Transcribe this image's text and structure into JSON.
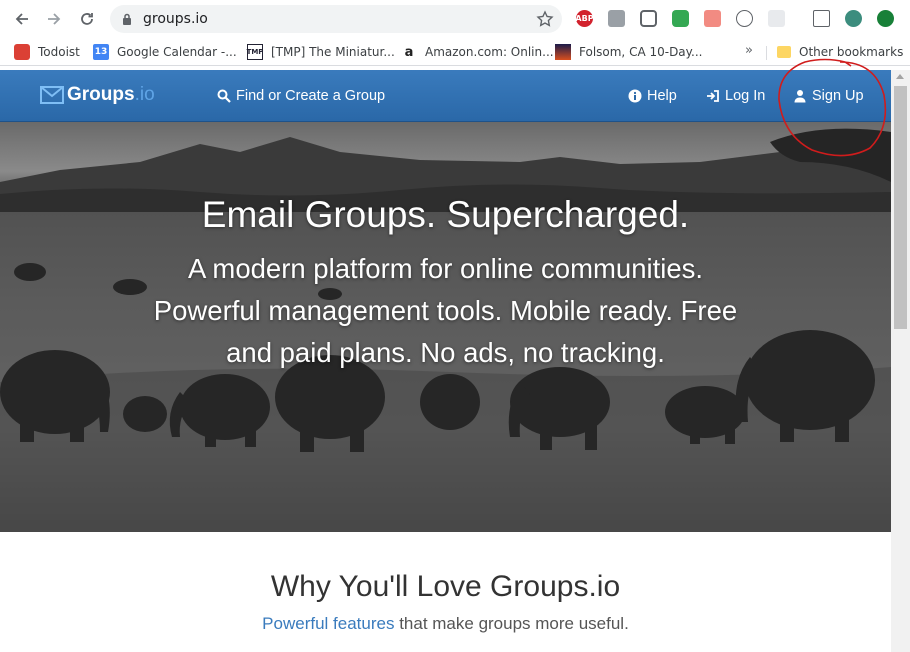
{
  "browser": {
    "url": "groups.io",
    "bookmarks": [
      {
        "label": "Todoist",
        "icon": "todoist-icon"
      },
      {
        "label": "Google Calendar -...",
        "icon": "calendar-icon"
      },
      {
        "label": "[TMP] The Miniatur...",
        "icon": "tmp-icon"
      },
      {
        "label": "Amazon.com: Onlin...",
        "icon": "amazon-icon"
      },
      {
        "label": "Folsom, CA 10-Day...",
        "icon": "weather-icon"
      }
    ],
    "overflow_label": "»",
    "other_bookmarks": "Other bookmarks",
    "calendar_day": "13",
    "tmp_badge": "TMP",
    "abp_badge": "ABP"
  },
  "site": {
    "logo_main": "Groups",
    "logo_tld": ".io",
    "nav": {
      "find": "Find or Create a Group",
      "help": "Help",
      "login": "Log In",
      "signup": "Sign Up"
    },
    "hero": {
      "title": "Email Groups. Supercharged.",
      "subtitle": "A modern platform for online communities. Powerful management tools. Mobile ready. Free and paid plans. No ads, no tracking."
    },
    "why": {
      "title": "Why You'll Love Groups.io",
      "link": "Powerful features",
      "rest": " that make groups more useful."
    }
  },
  "colors": {
    "navbar": "#2a68a8",
    "accent": "#3a7bbd",
    "annotation": "#d01c1c"
  }
}
